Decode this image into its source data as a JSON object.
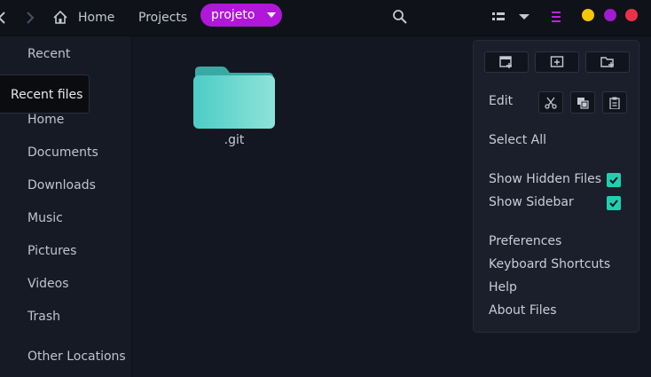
{
  "header": {
    "breadcrumbs": [
      "Home",
      "Projects"
    ],
    "current": "projeto"
  },
  "sidebar": {
    "items": [
      "Recent",
      "Home",
      "Documents",
      "Downloads",
      "Music",
      "Pictures",
      "Videos",
      "Trash",
      "Other Locations"
    ],
    "tooltip": "Recent files"
  },
  "content": {
    "files": [
      {
        "name": ".git",
        "type": "folder"
      }
    ]
  },
  "menu": {
    "edit_label": "Edit",
    "select_all": "Select All",
    "show_hidden": "Show Hidden Files",
    "show_sidebar": "Show Sidebar",
    "show_hidden_checked": true,
    "show_sidebar_checked": true,
    "preferences": "Preferences",
    "keyboard_shortcuts": "Keyboard Shortcuts",
    "help": "Help",
    "about": "About Files"
  },
  "colors": {
    "accent": "#b017d8",
    "check": "#1fd0b0",
    "folder": "#5ed6cc",
    "window_minimize": "#f4c700",
    "window_maximize": "#a21ad2",
    "window_close": "#e8324a"
  }
}
